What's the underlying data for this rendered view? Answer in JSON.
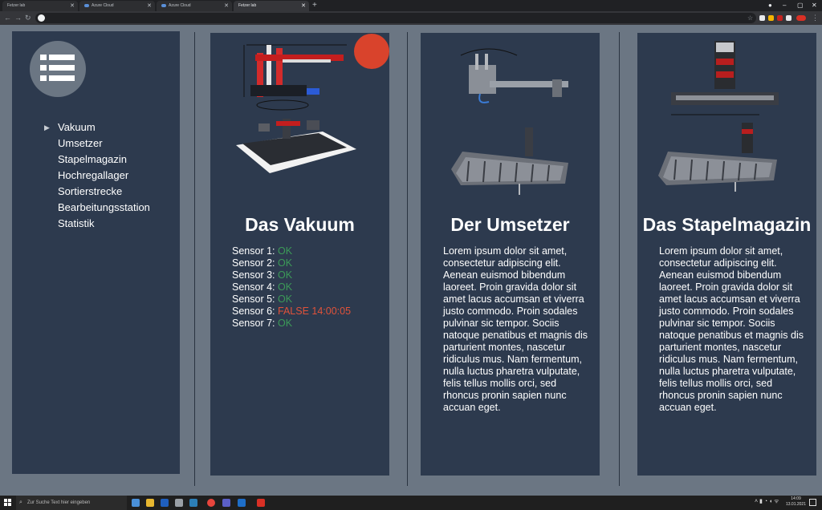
{
  "browser": {
    "tabs": [
      {
        "label": "Fetzer lab"
      },
      {
        "label": "Azure Cloud"
      },
      {
        "label": "Azure Cloud"
      },
      {
        "label": "Fetzer lab"
      }
    ],
    "new_tab": "+",
    "window_controls": [
      "–",
      "▢",
      "✕"
    ]
  },
  "sidebar": {
    "menu_icon": "list-menu-icon",
    "items": [
      {
        "label": "Vakuum"
      },
      {
        "label": "Umsetzer"
      },
      {
        "label": "Stapelmagazin"
      },
      {
        "label": "Hochregallager"
      },
      {
        "label": "Sortierstrecke"
      },
      {
        "label": "Bearbeitungsstation"
      },
      {
        "label": "Statistik"
      }
    ]
  },
  "cards": [
    {
      "title": "Das Vakuum",
      "sensors": [
        {
          "label": "Sensor 1:",
          "status": "OK"
        },
        {
          "label": "Sensor 2:",
          "status": "OK"
        },
        {
          "label": "Sensor 3:",
          "status": "OK"
        },
        {
          "label": "Sensor 4:",
          "status": "OK"
        },
        {
          "label": "Sensor 5:",
          "status": "OK"
        },
        {
          "label": "Sensor 6:",
          "status": "FALSE 14:00:05"
        },
        {
          "label": "Sensor 7:",
          "status": "OK"
        }
      ]
    },
    {
      "title": "Der Umsetzer",
      "text": "Lorem ipsum dolor sit amet, consectetur adipiscing elit. Aenean euismod bibendum laoreet. Proin gravida dolor sit amet lacus accumsan et viverra justo commodo. Proin sodales pulvinar sic tempor. Sociis natoque penatibus et magnis dis parturient montes, nascetur ridiculus mus. Nam fermentum, nulla luctus pharetra vulputate, felis tellus mollis orci, sed rhoncus pronin sapien nunc accuan eget."
    },
    {
      "title": "Das Stapelmagazin",
      "text": "Lorem ipsum dolor sit amet, consectetur adipiscing elit. Aenean euismod bibendum laoreet. Proin gravida dolor sit amet lacus accumsan et viverra justo commodo. Proin sodales pulvinar sic tempor. Sociis natoque penatibus et magnis dis parturient montes, nascetur ridiculus mus. Nam fermentum, nulla luctus pharetra vulputate, felis tellus mollis orci, sed rhoncus pronin sapien nunc accuan eget."
    }
  ],
  "taskbar": {
    "search_placeholder": "Zur Suche Text hier eingeben",
    "time": "14:09",
    "date": "13.01.2021"
  },
  "colors": {
    "page_bg": "#6b7683",
    "panel_bg": "#2d3a4e",
    "status_ok": "#3c9a58",
    "status_error": "#e0523a",
    "accent_circle": "#d9432c"
  }
}
